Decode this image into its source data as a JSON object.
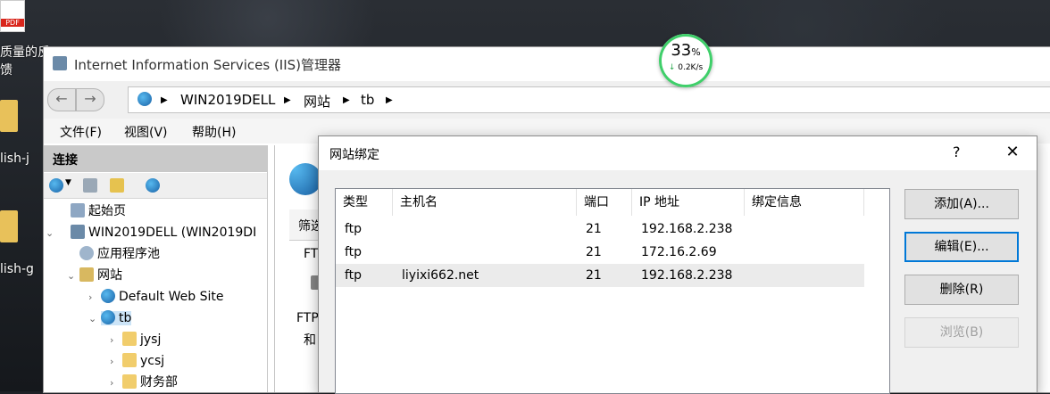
{
  "desktop": {
    "items": [
      {
        "label": "PDF"
      },
      {
        "label": "质量的反"
      },
      {
        "label": "馈"
      },
      {
        "label": "lish-j"
      },
      {
        "label": "lish-g"
      }
    ]
  },
  "window": {
    "title": "Internet Information Services (IIS)管理器",
    "breadcrumb": [
      "WIN2019DELL",
      "网站",
      "tb"
    ],
    "menu": [
      "文件(F)",
      "视图(V)",
      "帮助(H)"
    ]
  },
  "connections": {
    "header": "连接",
    "tree": [
      {
        "label": "起始页",
        "icon": "home-icon"
      },
      {
        "label": "WIN2019DELL (WIN2019DI",
        "icon": "server-icon"
      },
      {
        "label": "应用程序池",
        "icon": "app-pool-icon"
      },
      {
        "label": "网站",
        "icon": "sites-icon"
      },
      {
        "label": "Default Web Site",
        "icon": "globe-icon"
      },
      {
        "label": "tb",
        "icon": "globe-icon"
      },
      {
        "label": "jysj",
        "icon": "folder-icon"
      },
      {
        "label": "ycsj",
        "icon": "folder-icon"
      },
      {
        "label": "财务部",
        "icon": "folder-icon"
      }
    ]
  },
  "middle": {
    "filter_label": "筛选",
    "ftp_label": "FT",
    "ftp_text1": "FTP",
    "ftp_text2": "和"
  },
  "speed_widget": {
    "percent": "33",
    "unit": "%",
    "rate": "0.2K/s"
  },
  "dialog": {
    "title": "网站绑定",
    "help": "?",
    "close": "✕",
    "columns": [
      "类型",
      "主机名",
      "端口",
      "IP 地址",
      "绑定信息"
    ],
    "rows": [
      {
        "type": "ftp",
        "host": "",
        "port": "21",
        "ip": "192.168.2.238",
        "info": ""
      },
      {
        "type": "ftp",
        "host": "",
        "port": "21",
        "ip": "172.16.2.69",
        "info": ""
      },
      {
        "type": "ftp",
        "host": "liyixi662.net",
        "port": "21",
        "ip": "192.168.2.238",
        "info": ""
      }
    ],
    "buttons": {
      "add": "添加(A)...",
      "edit": "编辑(E)...",
      "remove": "删除(R)",
      "browse": "浏览(B)"
    }
  }
}
